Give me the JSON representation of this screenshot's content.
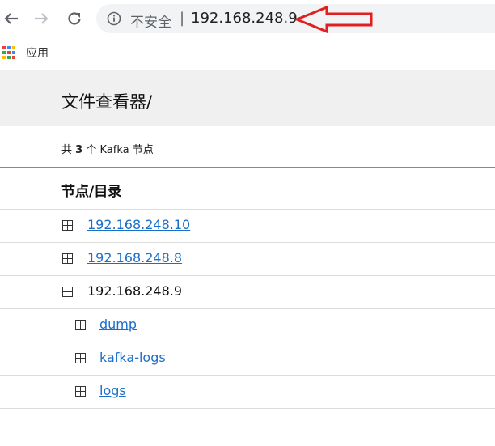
{
  "browser": {
    "security_label": "不安全",
    "separator": "|",
    "url": "192.168.248.9"
  },
  "bookmarks": {
    "apps_label": "应用"
  },
  "page": {
    "title": "文件查看器/",
    "summary": {
      "prefix": "共",
      "count": "3",
      "suffix": "个 Kafka 节点"
    },
    "column_header": "节点/目录",
    "tree": [
      {
        "label": "192.168.248.10",
        "state": "collapsed",
        "link": true
      },
      {
        "label": "192.168.248.8",
        "state": "collapsed",
        "link": true
      },
      {
        "label": "192.168.248.9",
        "state": "expanded",
        "link": false
      },
      {
        "label": "dump",
        "state": "collapsed",
        "link": true
      },
      {
        "label": "kafka-logs",
        "state": "collapsed",
        "link": true
      },
      {
        "label": "logs",
        "state": "collapsed",
        "link": true
      }
    ]
  },
  "colors": {
    "link": "#1a6fc9",
    "annotation_arrow": "#e02020"
  }
}
